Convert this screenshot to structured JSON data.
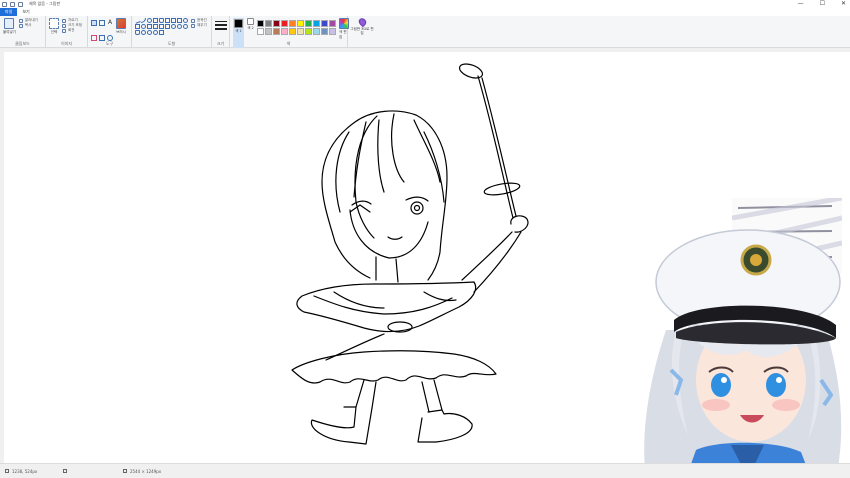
{
  "app": {
    "window_title": "제목 없음 - 그림판",
    "quick_access": [
      "save-icon",
      "undo-icon",
      "redo-icon"
    ],
    "window_controls": [
      "—",
      "☐",
      "✕"
    ]
  },
  "tabs": [
    {
      "label": "파일",
      "active": true
    },
    {
      "label": "보기",
      "active": false
    }
  ],
  "ribbon": {
    "clipboard": {
      "label": "클립보드",
      "paste": "붙여넣기",
      "cut": "잘라내기",
      "copy": "복사"
    },
    "image": {
      "label": "이미지",
      "select": "선택",
      "crop": "자르기",
      "resize": "크기 조정",
      "rotate": "회전"
    },
    "tools": {
      "label": "도구",
      "brushes": "브러시"
    },
    "shapes": {
      "label": "도형",
      "outline": "윤곽선",
      "fill": "채우기"
    },
    "size": {
      "label": "크기"
    },
    "colors": {
      "label": "색",
      "color1": "색 1",
      "color2": "색 2",
      "edit": "색 편집",
      "palette": [
        "#000000",
        "#7f7f7f",
        "#880015",
        "#ed1c24",
        "#ff7f27",
        "#fff200",
        "#22b14c",
        "#00a2e8",
        "#3f48cc",
        "#a349a4",
        "#ffffff",
        "#c3c3c3",
        "#b97a57",
        "#ffaec9",
        "#ffc90e",
        "#efe4b0",
        "#b5e61d",
        "#99d9ea",
        "#7092be",
        "#c8bfe7"
      ]
    },
    "paint3d": {
      "label": "그림판 3D로 편집"
    }
  },
  "status": {
    "position": "1238, 524px",
    "size": "2544 × 1249px"
  },
  "colors_main": {
    "accent": "#1e6fd9",
    "ribbon_bg": "#f5f6f7",
    "canvas_bg": "#f0f0f0"
  }
}
